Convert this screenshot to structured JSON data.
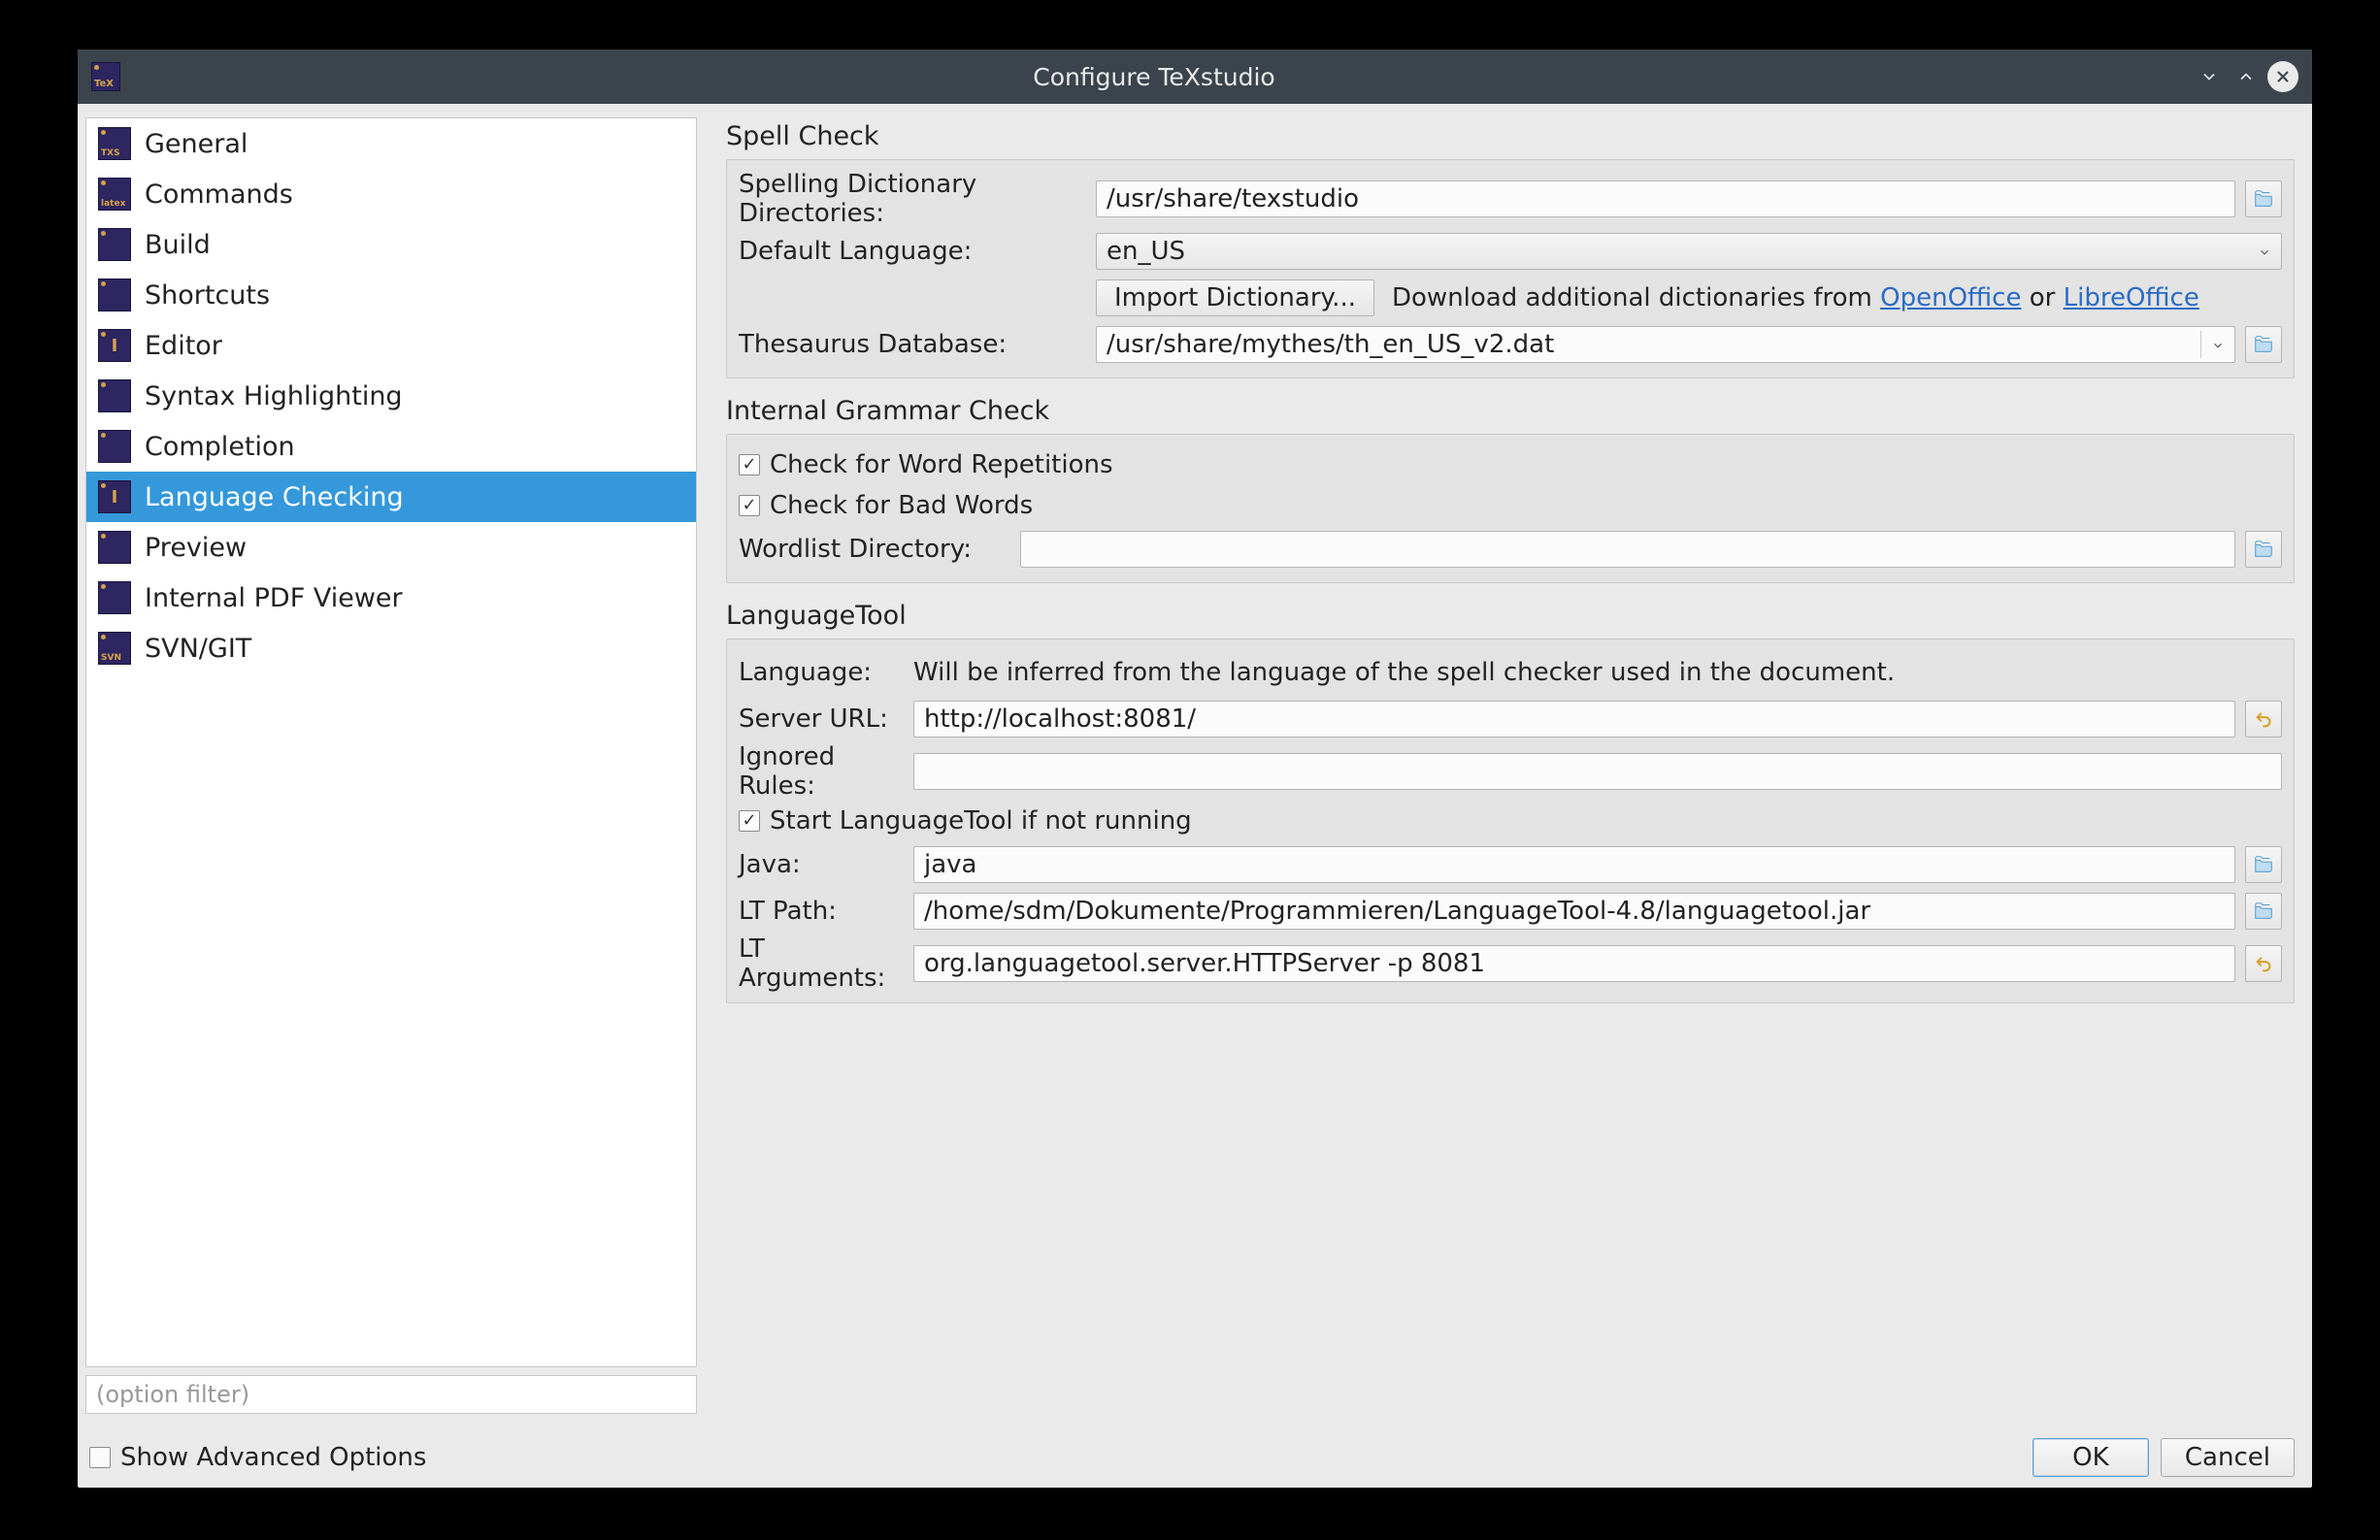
{
  "window": {
    "title": "Configure TeXstudio"
  },
  "sidebar": {
    "items": [
      {
        "label": "General",
        "icon": "TXS"
      },
      {
        "label": "Commands",
        "icon": "latex"
      },
      {
        "label": "Build",
        "icon": ""
      },
      {
        "label": "Shortcuts",
        "icon": ""
      },
      {
        "label": "Editor",
        "icon": "I"
      },
      {
        "label": "Syntax Highlighting",
        "icon": ""
      },
      {
        "label": "Completion",
        "icon": ""
      },
      {
        "label": "Language Checking",
        "icon": "I",
        "selected": true
      },
      {
        "label": "Preview",
        "icon": ""
      },
      {
        "label": "Internal PDF Viewer",
        "icon": ""
      },
      {
        "label": "SVN/GIT",
        "icon": "SVN"
      }
    ],
    "filter_placeholder": "(option filter)"
  },
  "sections": {
    "spell": {
      "title": "Spell Check",
      "dict_dir_label": "Spelling Dictionary Directories:",
      "dict_dir_value": "/usr/share/texstudio",
      "default_lang_label": "Default Language:",
      "default_lang_value": "en_US",
      "import_btn": "Import Dictionary...",
      "download_prefix": "Download additional dictionaries from ",
      "download_link1": "OpenOffice",
      "download_mid": " or ",
      "download_link2": "LibreOffice",
      "thesaurus_label": "Thesaurus Database:",
      "thesaurus_value": "/usr/share/mythes/th_en_US_v2.dat"
    },
    "grammar": {
      "title": "Internal Grammar Check",
      "word_rep_label": "Check for Word Repetitions",
      "bad_words_label": "Check for Bad Words",
      "wordlist_label": "Wordlist Directory:",
      "wordlist_value": ""
    },
    "lt": {
      "title": "LanguageTool",
      "lang_label": "Language:",
      "lang_info": "Will be inferred from the language of the spell checker used in the document.",
      "server_label": "Server URL:",
      "server_value": "http://localhost:8081/",
      "ignored_label": "Ignored Rules:",
      "ignored_value": "",
      "start_label": "Start LanguageTool if not running",
      "java_label": "Java:",
      "java_value": "java",
      "ltpath_label": "LT Path:",
      "ltpath_value": "/home/sdm/Dokumente/Programmieren/LanguageTool-4.8/languagetool.jar",
      "ltargs_label": "LT Arguments:",
      "ltargs_value": "org.languagetool.server.HTTPServer -p 8081"
    }
  },
  "footer": {
    "advanced_label": "Show Advanced Options",
    "ok": "OK",
    "cancel": "Cancel"
  }
}
